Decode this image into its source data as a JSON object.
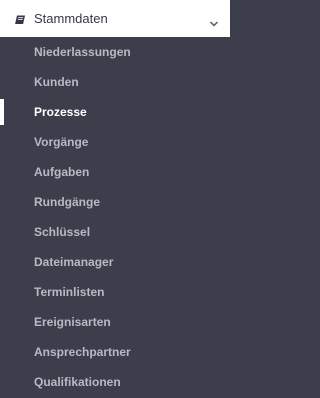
{
  "menu": {
    "title": "Stammdaten",
    "icon": "book-icon",
    "expand_icon": "chevron-down-icon",
    "items": [
      {
        "label": "Niederlassungen",
        "active": false
      },
      {
        "label": "Kunden",
        "active": false
      },
      {
        "label": "Prozesse",
        "active": true
      },
      {
        "label": "Vorgänge",
        "active": false
      },
      {
        "label": "Aufgaben",
        "active": false
      },
      {
        "label": "Rundgänge",
        "active": false
      },
      {
        "label": "Schlüssel",
        "active": false
      },
      {
        "label": "Dateimanager",
        "active": false
      },
      {
        "label": "Terminlisten",
        "active": false
      },
      {
        "label": "Ereignisarten",
        "active": false
      },
      {
        "label": "Ansprechpartner",
        "active": false
      },
      {
        "label": "Qualifikationen",
        "active": false
      }
    ]
  },
  "colors": {
    "sidebar_bg": "#3c3f4b",
    "header_bg": "#ffffff",
    "header_text": "#333844",
    "item_text": "#b7bac4",
    "active_text": "#ffffff",
    "active_indicator": "#ffffff"
  }
}
